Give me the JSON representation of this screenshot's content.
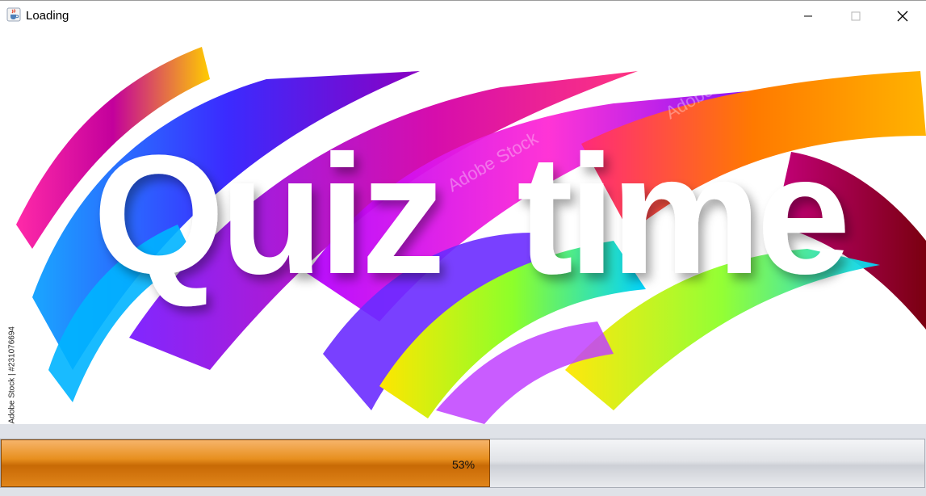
{
  "window": {
    "title": "Loading",
    "app_icon": "java-coffee-cup-icon",
    "controls": {
      "minimize": "minimize-icon",
      "maximize": "maximize-icon",
      "close": "close-icon"
    }
  },
  "banner": {
    "headline_word_1": "Quiz",
    "headline_word_2": "time",
    "side_credit": "Adobe Stock | #231076694",
    "watermark": "Adobe Stock",
    "stroke_colors": [
      "#ff2aa8",
      "#7a1cff",
      "#1f6bff",
      "#00d2ff",
      "#ffe600",
      "#ff8a00",
      "#c4007a",
      "#8a00c2"
    ]
  },
  "progress": {
    "value": 0.53,
    "label": "53%",
    "fill_color": "#e08a1e",
    "track_color": "#e1e3e7"
  }
}
